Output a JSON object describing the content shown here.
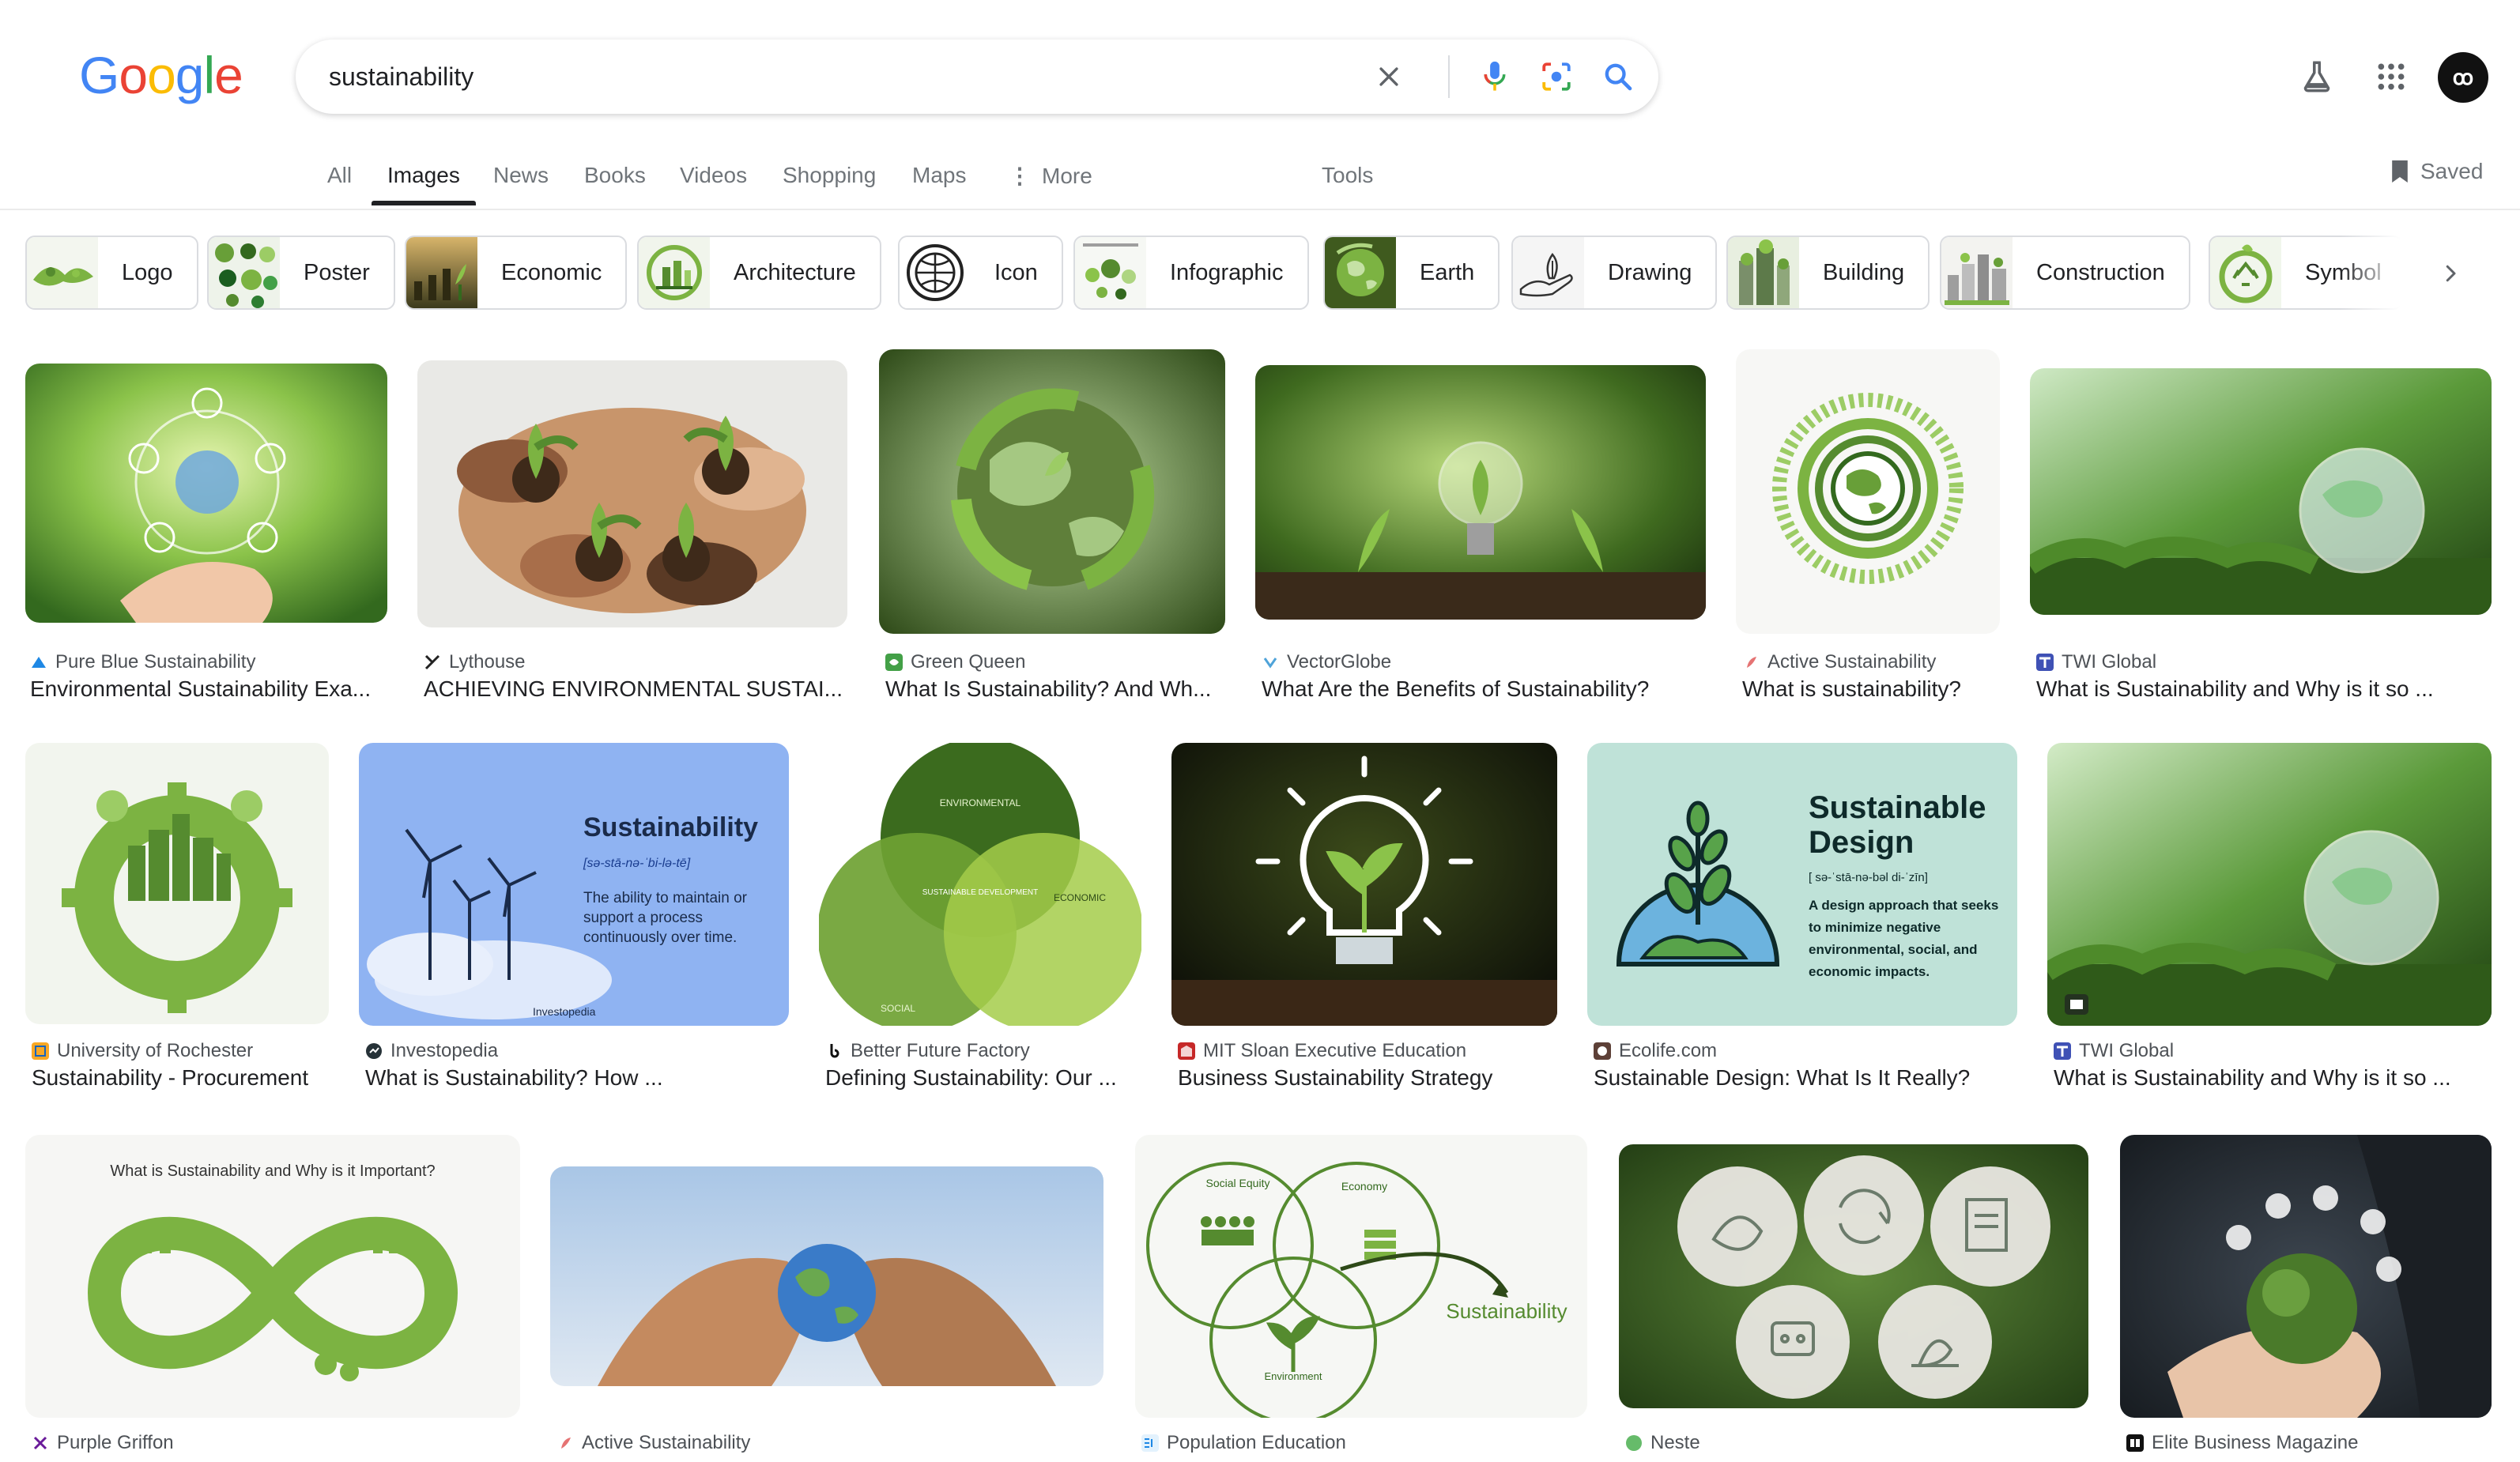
{
  "logo": [
    "G",
    "o",
    "o",
    "g",
    "l",
    "e"
  ],
  "search": {
    "value": "sustainability"
  },
  "avatar_text": "ꝏ",
  "tabs": [
    {
      "label": "All"
    },
    {
      "label": "Images"
    },
    {
      "label": "News"
    },
    {
      "label": "Books"
    },
    {
      "label": "Videos"
    },
    {
      "label": "Shopping"
    },
    {
      "label": "Maps"
    },
    {
      "label": "More"
    },
    {
      "label": "Tools"
    }
  ],
  "saved_label": "Saved",
  "chips": [
    {
      "label": "Logo"
    },
    {
      "label": "Poster"
    },
    {
      "label": "Economic"
    },
    {
      "label": "Architecture"
    },
    {
      "label": "Icon"
    },
    {
      "label": "Infographic"
    },
    {
      "label": "Earth"
    },
    {
      "label": "Drawing"
    },
    {
      "label": "Building"
    },
    {
      "label": "Construction"
    },
    {
      "label": "Symbol"
    }
  ],
  "results": [
    {
      "source": "Pure Blue Sustainability",
      "title": "Environmental Sustainability Exa..."
    },
    {
      "source": "Lythouse",
      "title": "ACHIEVING ENVIRONMENTAL SUSTAI..."
    },
    {
      "source": "Green Queen",
      "title": "What Is Sustainability? And Wh..."
    },
    {
      "source": "VectorGlobe",
      "title": "What Are the Benefits of Sustainability?"
    },
    {
      "source": "Active Sustainability",
      "title": "What is sustainability?"
    },
    {
      "source": "TWI Global",
      "title": "What is Sustainability and Why is it so ..."
    },
    {
      "source": "University of Rochester",
      "title": "Sustainability - Procurement"
    },
    {
      "source": "Investopedia",
      "title": "What is Sustainability? How ..."
    },
    {
      "source": "Better Future Factory",
      "title": "Defining Sustainability: Our ..."
    },
    {
      "source": "MIT Sloan Executive Education",
      "title": "Business Sustainability Strategy"
    },
    {
      "source": "Ecolife.com",
      "title": "Sustainable Design: What Is It Really?"
    },
    {
      "source": "TWI Global",
      "title": "What is Sustainability and Why is it so ..."
    },
    {
      "source": "Purple Griffon",
      "title": ""
    },
    {
      "source": "Active Sustainability",
      "title": ""
    },
    {
      "source": "Population Education",
      "title": ""
    },
    {
      "source": "Neste",
      "title": ""
    },
    {
      "source": "Elite Business Magazine",
      "title": ""
    }
  ],
  "image_text": {
    "investopedia_title": "Sustainability",
    "investopedia_phon": "[sə-stā-nə-ˈbi-lə-tē]",
    "investopedia_def": "The ability to maintain or support a process continuously over time.",
    "investopedia_brand": "Investopedia",
    "ecolife_title": "Sustainable Design",
    "ecolife_phon": "[ sə-ˈstā-nə-bəl di-ˈzīn]",
    "ecolife_def": "A design approach that seeks to minimize negative environmental, social, and economic impacts.",
    "griffon_heading": "What is Sustainability and Why is it Important?",
    "pop_social": "Social Equity",
    "pop_economy": "Economy",
    "pop_environment": "Environment",
    "pop_sustainability": "Sustainability",
    "bff_environmental": "ENVIRONMENTAL",
    "bff_economic": "ECONOMIC",
    "bff_social": "SOCIAL",
    "bff_center": "SUSTAINABLE DEVELOPMENT"
  },
  "colors": {
    "google_blue": "#4285F4",
    "google_red": "#EA4335",
    "google_yellow": "#FBBC05",
    "google_green": "#34A853",
    "text_primary": "#202124",
    "text_secondary": "#70757a"
  }
}
